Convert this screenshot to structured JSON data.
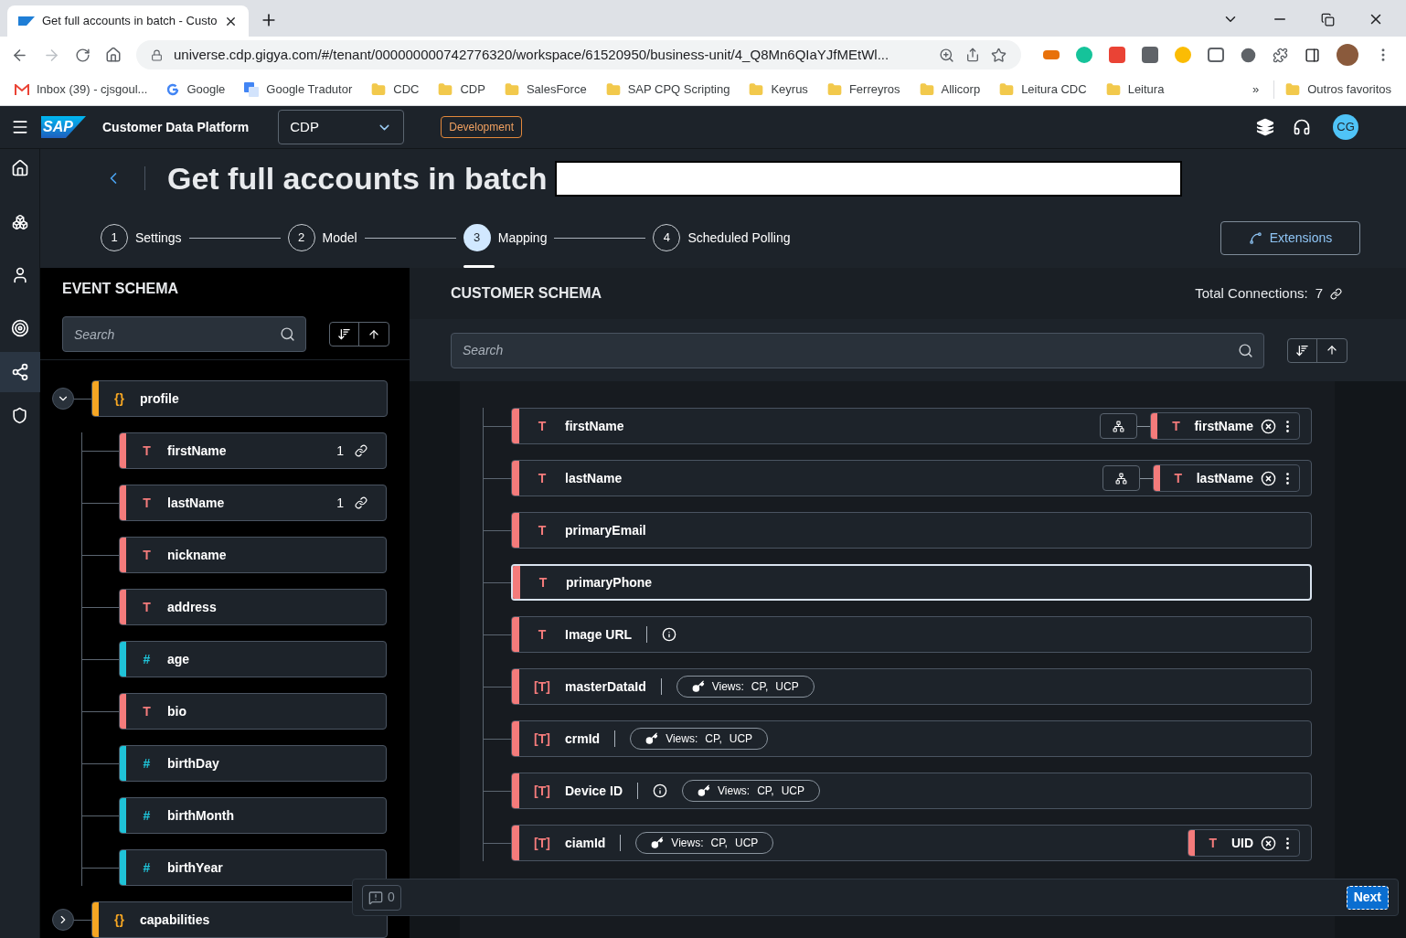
{
  "browser": {
    "tab_title": "Get full accounts in batch - Custo",
    "url": "universe.cdp.gigya.com/#/tenant/000000000742776320/workspace/61520950/business-unit/4_Q8Mn6QIaYJfMEtWl...",
    "bookmarks": [
      {
        "label": "Inbox (39) - cjsgoul...",
        "kind": "gmail"
      },
      {
        "label": "Google",
        "kind": "google"
      },
      {
        "label": "Google Tradutor",
        "kind": "translate"
      },
      {
        "label": "CDC",
        "kind": "folder"
      },
      {
        "label": "CDP",
        "kind": "folder"
      },
      {
        "label": "SalesForce",
        "kind": "folder"
      },
      {
        "label": "SAP CPQ Scripting",
        "kind": "folder"
      },
      {
        "label": "Keyrus",
        "kind": "folder"
      },
      {
        "label": "Ferreyros",
        "kind": "folder"
      },
      {
        "label": "Allicorp",
        "kind": "folder"
      },
      {
        "label": "Leitura CDC",
        "kind": "folder"
      },
      {
        "label": "Leitura",
        "kind": "folder"
      }
    ],
    "overflow": "»",
    "other_bookmarks": "Outros favoritos"
  },
  "header": {
    "logo": "SAP",
    "product": "Customer Data Platform",
    "workspace": "CDP",
    "environment": "Development",
    "avatar": "CG"
  },
  "page": {
    "title": "Get full accounts in batch",
    "steps": [
      {
        "number": "1",
        "label": "Settings",
        "selected": false
      },
      {
        "number": "2",
        "label": "Model",
        "selected": false
      },
      {
        "number": "3",
        "label": "Mapping",
        "selected": true
      },
      {
        "number": "4",
        "label": "Scheduled Polling",
        "selected": false
      }
    ],
    "extensions": "Extensions"
  },
  "event_schema": {
    "title": "EVENT SCHEMA",
    "search_placeholder": "Search",
    "root": {
      "name": "profile",
      "type_label": "{}",
      "kind": "object",
      "expanded": true,
      "children": [
        {
          "name": "firstName",
          "type_label": "T",
          "kind": "string",
          "count": "1"
        },
        {
          "name": "lastName",
          "type_label": "T",
          "kind": "string",
          "count": "1"
        },
        {
          "name": "nickname",
          "type_label": "T",
          "kind": "string"
        },
        {
          "name": "address",
          "type_label": "T",
          "kind": "string"
        },
        {
          "name": "age",
          "type_label": "#",
          "kind": "number"
        },
        {
          "name": "bio",
          "type_label": "T",
          "kind": "string"
        },
        {
          "name": "birthDay",
          "type_label": "#",
          "kind": "number"
        },
        {
          "name": "birthMonth",
          "type_label": "#",
          "kind": "number"
        },
        {
          "name": "birthYear",
          "type_label": "#",
          "kind": "number"
        }
      ]
    },
    "next_root": {
      "name": "capabilities",
      "type_label": "{}",
      "kind": "object",
      "expanded": false
    }
  },
  "customer_schema": {
    "title": "CUSTOMER SCHEMA",
    "connections_label": "Total Connections:",
    "connections": "7",
    "search_placeholder": "Search",
    "rows": [
      {
        "name": "firstName",
        "type_label": "T",
        "selected": false,
        "hierarchy": true,
        "mapping": {
          "type_label": "T",
          "name": "firstName"
        }
      },
      {
        "name": "lastName",
        "type_label": "T",
        "selected": false,
        "hierarchy": true,
        "mapping": {
          "type_label": "T",
          "name": "lastName"
        }
      },
      {
        "name": "primaryEmail",
        "type_label": "T",
        "selected": false
      },
      {
        "name": "primaryPhone",
        "type_label": "T",
        "selected": true
      },
      {
        "name": "Image URL",
        "type_label": "T",
        "selected": false,
        "info": true
      },
      {
        "name": "masterDataId",
        "type_label": "[T]",
        "selected": false,
        "views": {
          "label": "Views:",
          "values": [
            "CP,",
            "UCP"
          ]
        }
      },
      {
        "name": "crmId",
        "type_label": "[T]",
        "selected": false,
        "views": {
          "label": "Views:",
          "values": [
            "CP,",
            "UCP"
          ]
        }
      },
      {
        "name": "Device ID",
        "type_label": "[T]",
        "selected": false,
        "info": true,
        "views": {
          "label": "Views:",
          "values": [
            "CP,",
            "UCP"
          ]
        }
      },
      {
        "name": "ciamId",
        "type_label": "[T]",
        "selected": false,
        "views": {
          "label": "Views:",
          "values": [
            "CP,",
            "UCP"
          ]
        },
        "mapping": {
          "type_label": "T",
          "name": "UID"
        }
      }
    ]
  },
  "footer": {
    "messages": "0",
    "next": "Next"
  }
}
